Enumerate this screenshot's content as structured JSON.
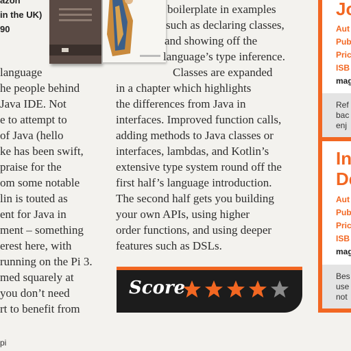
{
  "left_meta": {
    "lines": [
      "azon",
      "in the UK)",
      "90",
      ""
    ]
  },
  "left_column": {
    "lines": [
      " language",
      "he people behind",
      "Java IDE. Not",
      "e to attempt to",
      " of Java (hello",
      "ke has been swift,",
      "praise for the",
      "om some notable",
      "lin is touted as",
      "ent for Java in",
      "ment – something",
      "erest here, with",
      "running on the Pi 3.",
      "med squarely at",
      "you don’t need",
      "rt to benefit from"
    ]
  },
  "middle_column": {
    "top_lines": [
      "boilerplate in examples",
      "such as declaring classes,",
      "and showing off the",
      "language’s type inference."
    ],
    "lines": [
      "Classes are expanded",
      "in a chapter which highlights",
      "the differences from Java in",
      "interfaces. Improved function calls,",
      "adding methods to Java classes or",
      "interfaces, lambdas, and Kotlin’s",
      "extensive type system round off the",
      "first half’s language introduction.",
      "The second half gets you building",
      "your own APIs, using higher",
      "order functions, and using deeper",
      "features such as DSLs."
    ]
  },
  "score": {
    "label": "Score",
    "rating": 4,
    "max": 5,
    "filled_color": "#f26722",
    "empty_color": "#8a8a8a"
  },
  "sidebar": {
    "title1": "Jo",
    "labels1": [
      "Aut",
      "Pub",
      "Pric",
      "ISB"
    ],
    "url1": "mag",
    "desc1": [
      "Ref",
      "bac",
      "enj"
    ],
    "title2": [
      "In",
      "De"
    ],
    "labels2": [
      "Aut",
      "Pub",
      "Pric",
      "ISB"
    ],
    "url2": "mag",
    "desc2": [
      "Bes",
      "use",
      "not"
    ]
  },
  "folio": "pi"
}
